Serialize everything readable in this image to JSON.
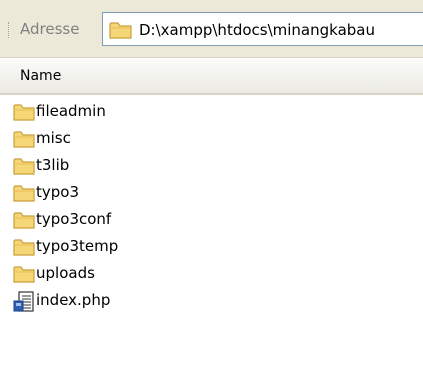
{
  "address_bar": {
    "label": "Adresse",
    "path": "D:\\xampp\\htdocs\\minangkabau",
    "icon": "folder-icon"
  },
  "columns": {
    "name": "Name"
  },
  "files": [
    {
      "name": "fileadmin",
      "icon": "folder-icon"
    },
    {
      "name": "misc",
      "icon": "folder-icon"
    },
    {
      "name": "t3lib",
      "icon": "folder-icon"
    },
    {
      "name": "typo3",
      "icon": "folder-icon"
    },
    {
      "name": "typo3conf",
      "icon": "folder-icon"
    },
    {
      "name": "typo3temp",
      "icon": "folder-icon"
    },
    {
      "name": "uploads",
      "icon": "folder-icon"
    },
    {
      "name": "index.php",
      "icon": "php-file-icon"
    }
  ],
  "colors": {
    "folder_fill": "#f6d778",
    "folder_stroke": "#c9a13a",
    "toolbar_bg": "#ece9d8",
    "field_border": "#7f9db9"
  }
}
